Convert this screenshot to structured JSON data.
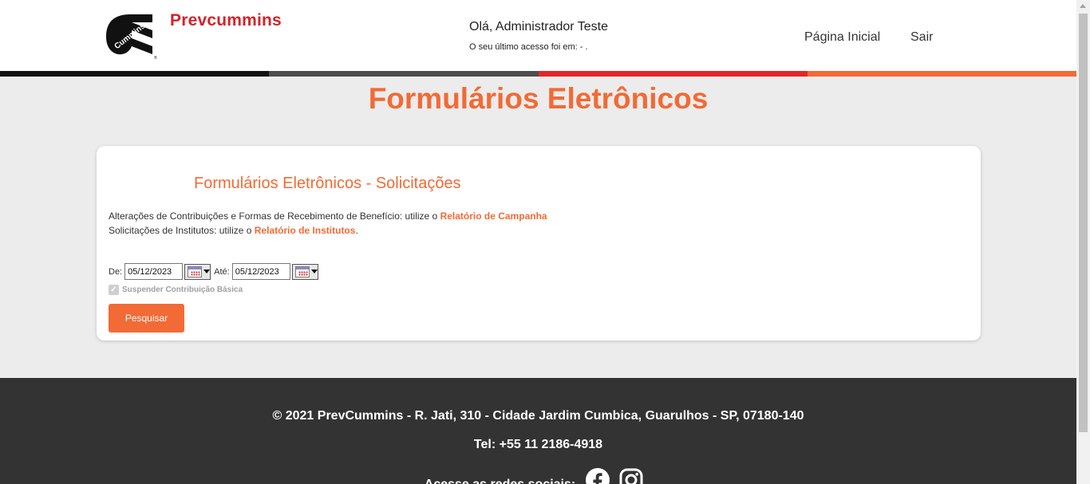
{
  "header": {
    "brand": "Prevcummins",
    "logo_text": "Cummins",
    "greeting": "Olá, Administrador Teste",
    "last_access": "O seu último acesso foi em: - .",
    "nav_home": "Página Inicial",
    "nav_exit": "Sair"
  },
  "stripe_colors": [
    "#111111",
    "#4d4d4d",
    "#e3262a",
    "#f26a35"
  ],
  "page": {
    "title": "Formulários Eletrônicos"
  },
  "card": {
    "title": "Formulários Eletrônicos - Solicitações",
    "info1_text": "Alterações de Contribuições e Formas de Recebimento de Benefício: utilize o ",
    "info1_link": "Relatório de Campanha",
    "info2_text": "Solicitações de Institutos: utilize o ",
    "info2_link": "Relatório de Institutos",
    "info2_suffix": ".",
    "from_label": "De:",
    "from_value": "05/12/2023",
    "to_label": "Até:",
    "to_value": "05/12/2023",
    "checkbox_label": "Suspender Contribuição Básica",
    "checkbox_checked": true,
    "search_button": "Pesquisar"
  },
  "footer": {
    "address": "© 2021 PrevCummins - R. Jati, 310 - Cidade Jardim Cumbica, Guarulhos - SP, 07180-140",
    "phone": "Tel: +55 11 2186-4918",
    "social_label": "Acesse as redes sociais:",
    "social_icons": [
      "facebook-icon",
      "instagram-icon"
    ]
  },
  "colors": {
    "accent": "#f26a35",
    "brand_red": "#d2232a",
    "footer_bg": "#333333",
    "page_bg": "#ececec"
  }
}
